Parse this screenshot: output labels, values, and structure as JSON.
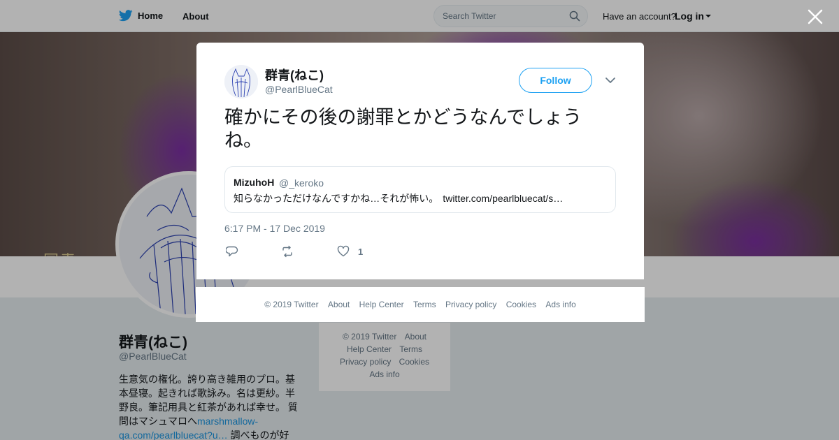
{
  "topbar": {
    "home_label": "Home",
    "about_label": "About",
    "search_placeholder": "Search Twitter",
    "have_account": "Have an account?",
    "login_label": "Log in"
  },
  "banner_text": "国青",
  "profile": {
    "name": "群青(ねこ)",
    "handle": "@PearlBlueCat",
    "bio_text": "生意気の権化。誇り高き雑用のプロ。基本昼寝。起きれば歌詠み。名は更紗。半野良。筆記用具と紅茶があれば幸せ。 質問はマシュマロへ",
    "bio_link": "marshmallow-qa.com/pearlbluecat?u…",
    "bio_tail": " 調べものが好"
  },
  "side_footer": {
    "items": [
      "© 2019 Twitter",
      "About",
      "Help Center",
      "Terms",
      "Privacy policy",
      "Cookies",
      "Ads info"
    ]
  },
  "tweet": {
    "author_name": "群青(ねこ)",
    "author_handle": "@PearlBlueCat",
    "follow_label": "Follow",
    "text": "確かにその後の謝罪とかどうなんでしょうね。",
    "quote": {
      "name": "MizuhoH",
      "handle": "@_keroko",
      "text": "知らなかっただけなんですかね…それが怖い。",
      "link": "twitter.com/pearlbluecat/s…"
    },
    "timestamp": "6:17 PM - 17 Dec 2019",
    "like_count": "1"
  },
  "modal_footer": {
    "items": [
      "© 2019 Twitter",
      "About",
      "Help Center",
      "Terms",
      "Privacy policy",
      "Cookies",
      "Ads info"
    ]
  },
  "colors": {
    "accent": "#1da1f2",
    "secondary_text": "#657786",
    "link": "#1b95e0"
  }
}
